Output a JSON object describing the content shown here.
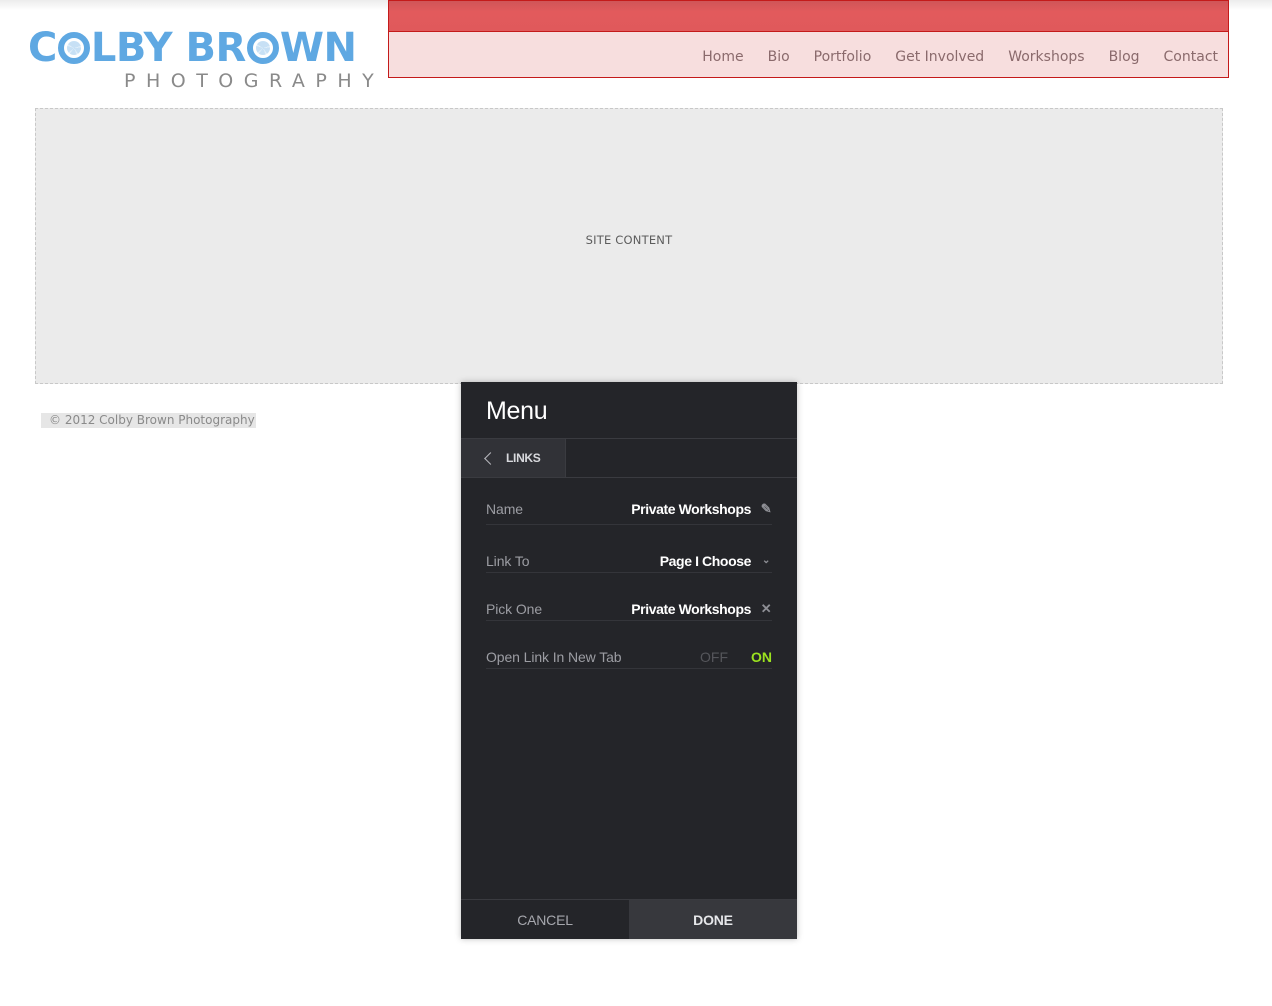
{
  "site": {
    "logo": {
      "main_prefix": "C",
      "main_mid": "LBY BR",
      "main_suffix": "WN",
      "sub": "PHOTOGRAPHY"
    },
    "nav": [
      "Home",
      "Bio",
      "Portfolio",
      "Get Involved",
      "Workshops",
      "Blog",
      "Contact"
    ],
    "content_placeholder": "SITE CONTENT",
    "footer": "© 2012 Colby Brown Photography",
    "colors": {
      "brand_blue": "#5fa8e2",
      "nav_red": "#e0595b",
      "nav_bg": "#f7dede"
    }
  },
  "panel": {
    "title": "Menu",
    "back_tab": {
      "label": "LINKS",
      "icon": "chevron-left-icon"
    },
    "fields": [
      {
        "label": "Name",
        "value": "Private Workshops",
        "icon": "pencil-icon"
      },
      {
        "label": "Link To",
        "value": "Page I Choose",
        "icon": "chevron-down-icon"
      },
      {
        "label": "Pick One",
        "value": "Private Workshops",
        "icon": "close-icon"
      }
    ],
    "toggle": {
      "label": "Open Link In New Tab",
      "off": "OFF",
      "on": "ON",
      "state": "on"
    },
    "buttons": {
      "cancel": "CANCEL",
      "done": "DONE"
    },
    "colors": {
      "background": "#242529",
      "on_accent": "#9be21f"
    }
  }
}
